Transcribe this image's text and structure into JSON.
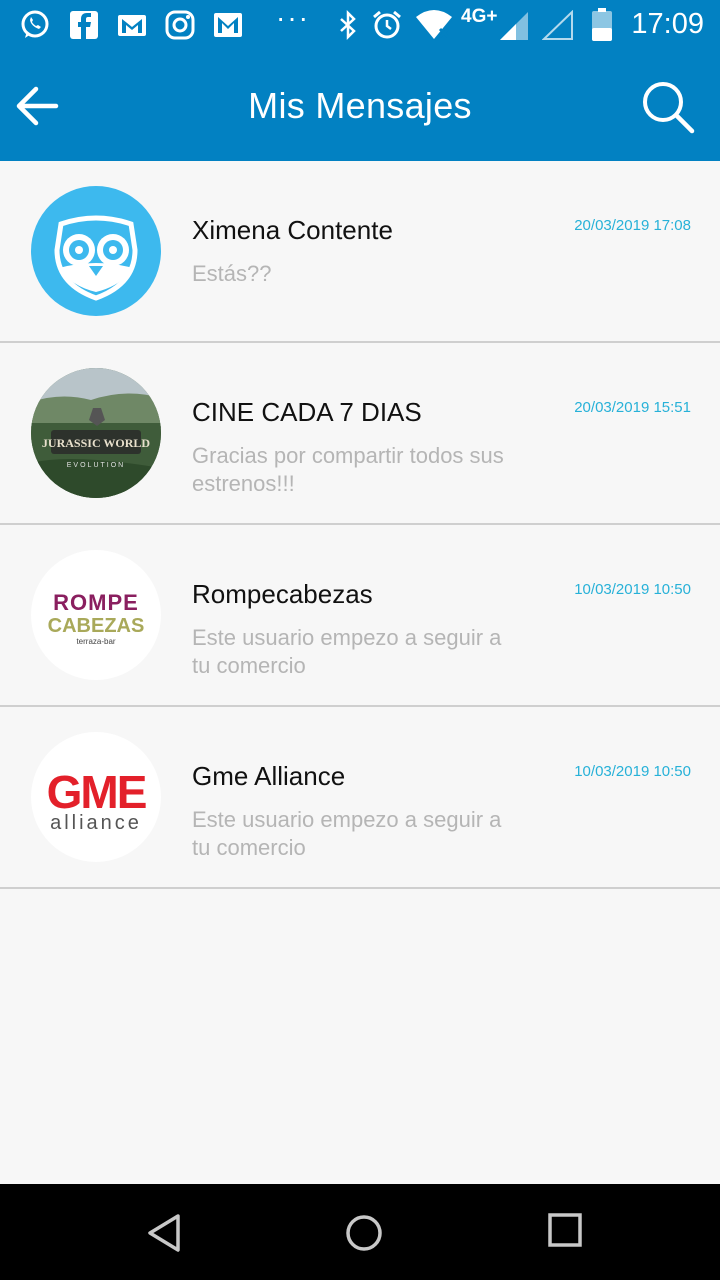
{
  "status_bar": {
    "time": "17:09",
    "network": "4G+",
    "more": "···",
    "icons": [
      "whatsapp-icon",
      "facebook-icon",
      "gmail-icon",
      "instagram-icon",
      "inbox-icon",
      "bluetooth-icon",
      "alarm-icon",
      "wifi-icon",
      "signal-icon",
      "signal-empty-icon",
      "battery-icon"
    ]
  },
  "app_bar": {
    "title": "Mis Mensajes",
    "back_icon": "arrow-left-icon",
    "search_icon": "search-icon",
    "color": "#0281c2"
  },
  "messages": [
    {
      "name": "Ximena Contente",
      "preview": "Estás??",
      "date": "20/03/2019 17:08",
      "avatar": "owl-logo"
    },
    {
      "name": "CINE CADA 7 DIAS",
      "preview": "Gracias por compartir todos sus estrenos!!!",
      "date": "20/03/2019 15:51",
      "avatar": "jurassic-world-photo",
      "avatar_text": "JURASSIC WORLD",
      "avatar_subtext": "EVOLUTION"
    },
    {
      "name": "Rompecabezas",
      "preview": "Este usuario empezo a seguir a tu comercio",
      "date": "10/03/2019 10:50",
      "avatar": "rompecabezas-logo",
      "avatar_text_1": "ROMPE",
      "avatar_text_2": "CABEZAS",
      "avatar_subtext": "terraza-bar"
    },
    {
      "name": "Gme Alliance",
      "preview": "Este usuario empezo a seguir a tu comercio",
      "date": "10/03/2019 10:50",
      "avatar": "gme-alliance-logo",
      "avatar_text": "GME",
      "avatar_subtext": "alliance"
    }
  ],
  "colors": {
    "accent": "#0281c2",
    "date": "#27b1d8",
    "preview": "#b5b5b5",
    "gme_red": "#e3202a"
  },
  "nav_bar": {
    "back_icon": "triangle-back-icon",
    "home_icon": "circle-home-icon",
    "recents_icon": "square-recents-icon"
  }
}
